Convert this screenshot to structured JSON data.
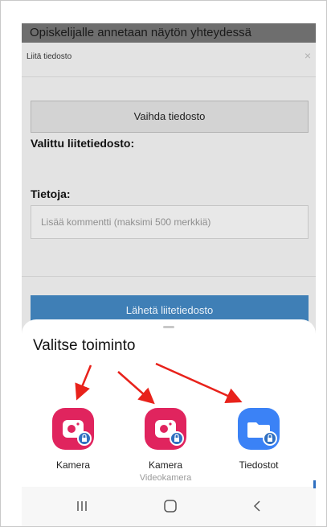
{
  "banner": {
    "text": "Opiskelijalle annetaan näytön yhteydessä"
  },
  "modal": {
    "title": "Liitä tiedosto",
    "close_symbol": "×",
    "change_button": "Vaihda tiedosto",
    "selected_file_label": "Valittu liitetiedosto:",
    "info_label": "Tietoja:",
    "comment_placeholder": "Lisää kommentti (maksimi 500 merkkiä)",
    "send_button": "Lähetä liitetiedosto"
  },
  "sheet": {
    "title": "Valitse toiminto",
    "apps": [
      {
        "label": "Kamera",
        "sublabel": "",
        "icon": "camera-icon",
        "color": "#e0245e"
      },
      {
        "label": "Kamera",
        "sublabel": "Videokamera",
        "icon": "video-camera-icon",
        "color": "#e0245e"
      },
      {
        "label": "Tiedostot",
        "sublabel": "",
        "icon": "folder-icon",
        "color": "#3b82f6"
      }
    ]
  },
  "navbar": {
    "icons": [
      "recent-apps-icon",
      "home-icon",
      "back-icon"
    ]
  },
  "colors": {
    "annotation_arrow": "#e8221b",
    "send_button": "#3f7fb6",
    "badge": "#2f6fc0"
  }
}
